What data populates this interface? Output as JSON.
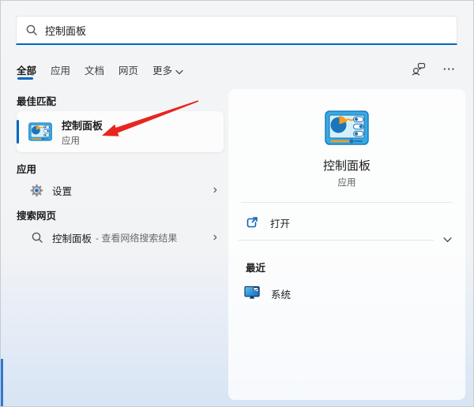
{
  "search_box": {
    "value": "控制面板"
  },
  "tabs": [
    {
      "label": "全部"
    },
    {
      "label": "应用"
    },
    {
      "label": "文档"
    },
    {
      "label": "网页"
    },
    {
      "label": "更多"
    }
  ],
  "left_panel": {
    "best_match": {
      "heading": "最佳匹配",
      "item": {
        "title": "控制面板",
        "subtitle": "应用"
      }
    },
    "apps": {
      "heading": "应用",
      "items": [
        {
          "label": "设置"
        }
      ]
    },
    "web_search": {
      "heading": "搜索网页",
      "items": [
        {
          "title": "控制面板",
          "hint": "- 查看网络搜索结果"
        }
      ]
    }
  },
  "right_panel": {
    "app": {
      "title": "控制面板",
      "subtitle": "应用"
    },
    "actions": [
      {
        "label": "打开"
      }
    ],
    "recent": {
      "heading": "最近",
      "items": [
        {
          "label": "系统"
        }
      ]
    }
  },
  "glyphs": {
    "chevron_right": "›",
    "more": "···"
  },
  "icons": {
    "search": "magnifier",
    "user_feedback": "person-with-chat-bubble",
    "more_options": "ellipsis",
    "dropdown": "chevron-down",
    "settings": "gear-with-blue-center",
    "control_panel": "blue-panel-with-pie-chart",
    "open": "arrow-out-of-box",
    "system": "monitor-with-check",
    "annotation": "red-arrow"
  },
  "colors": {
    "accent": "#0067c0",
    "arrow": "#e8251f"
  }
}
